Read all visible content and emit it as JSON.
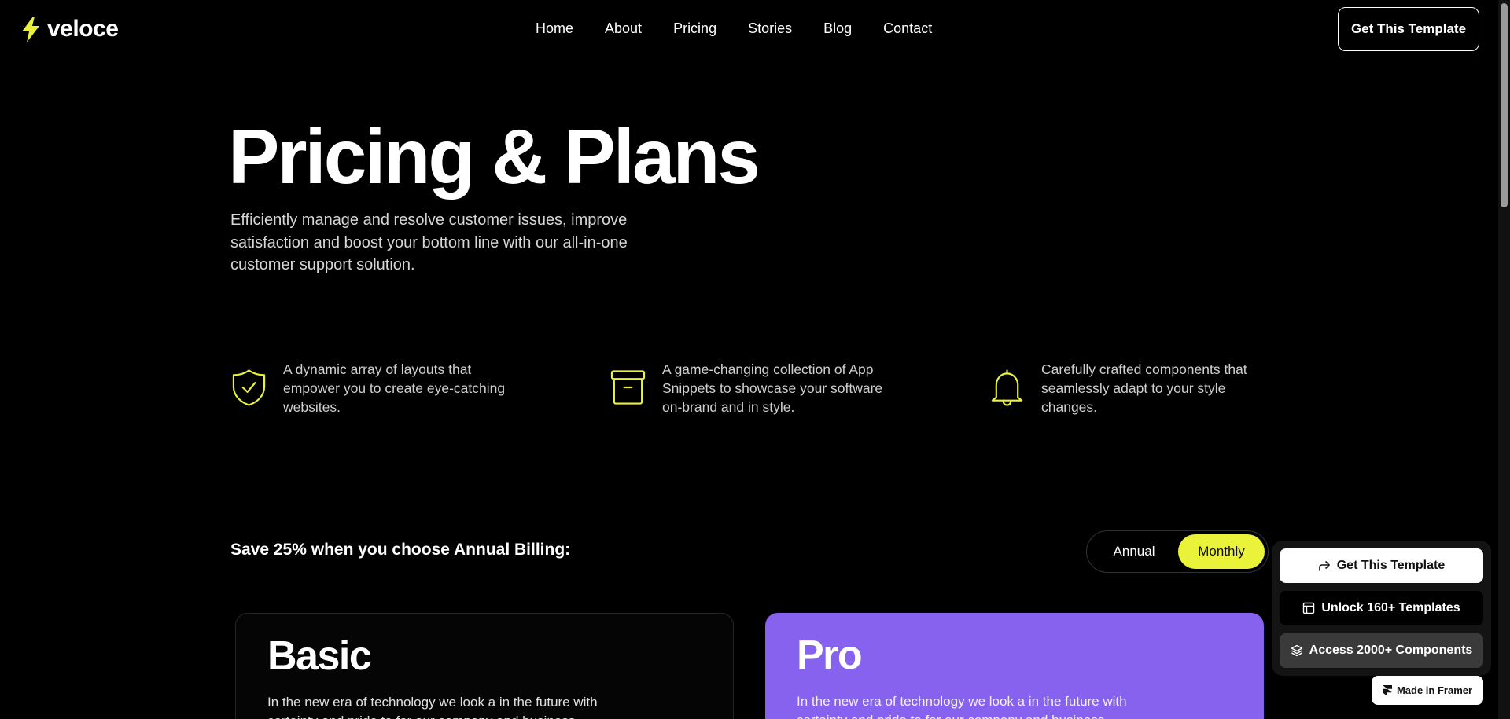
{
  "brand": {
    "name": "veloce",
    "accent": "#eaf23a",
    "pro_color": "#8662ee"
  },
  "nav": {
    "items": [
      {
        "label": "Home"
      },
      {
        "label": "About"
      },
      {
        "label": "Pricing"
      },
      {
        "label": "Stories"
      },
      {
        "label": "Blog"
      },
      {
        "label": "Contact"
      }
    ],
    "cta_label": "Get This Template"
  },
  "hero": {
    "title": "Pricing & Plans",
    "subtitle": "Efficiently manage and resolve customer issues, improve satisfaction and boost your bottom line with our all-in-one customer support solution."
  },
  "features": [
    {
      "icon": "shield-check-icon",
      "text": "A dynamic array of layouts that empower you to create eye-catching websites."
    },
    {
      "icon": "archive-box-icon",
      "text": "A game-changing collection of App Snippets to showcase your software on-brand and in style."
    },
    {
      "icon": "bell-icon",
      "text": "Carefully crafted components that seamlessly adapt to your style changes."
    }
  ],
  "billing": {
    "label": "Save 25% when you choose Annual Billing:",
    "options": {
      "annual": "Annual",
      "monthly": "Monthly"
    },
    "selected": "Monthly"
  },
  "plans": [
    {
      "name": "Basic",
      "description": "In the new era of technology we look a in the future with certainty and pride to for our company and business."
    },
    {
      "name": "Pro",
      "description": "In the new era of technology we look a in the future with certainty and pride to for our company and business."
    }
  ],
  "floating": {
    "get_template": "Get This Template",
    "unlock": "Unlock 160+ Templates",
    "access": "Access 2000+ Components",
    "made_in": "Made in Framer"
  }
}
